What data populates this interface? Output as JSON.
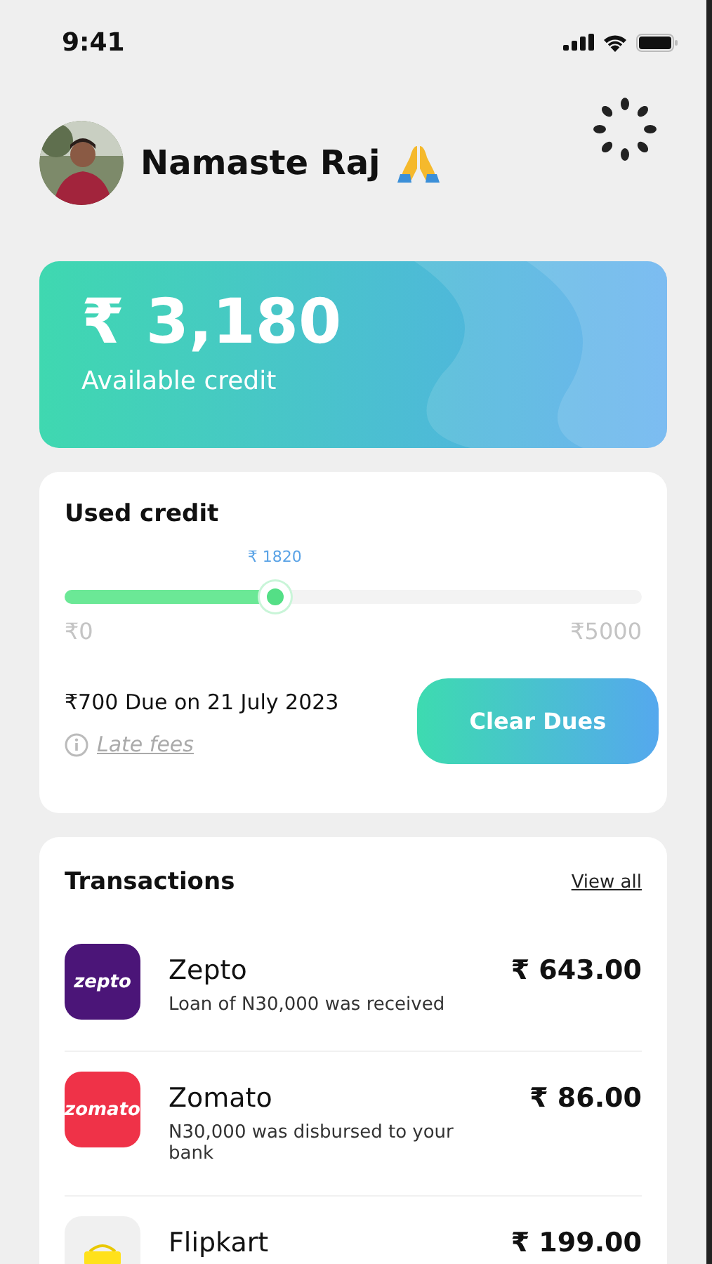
{
  "status_bar": {
    "time": "9:41"
  },
  "header": {
    "greeting": "Namaste Raj"
  },
  "balance": {
    "amount": "₹ 3,180",
    "label": "Available credit"
  },
  "used_credit": {
    "title": "Used credit",
    "slider": {
      "level": 0.364,
      "reading": "₹ 1820",
      "min_label": "₹0",
      "max_label": "₹5000"
    },
    "due": "₹700 Due on 21 July 2023",
    "late_fees": "Late fees",
    "button": "Clear Dues"
  },
  "transactions": {
    "title": "Transactions",
    "view_all": "View all",
    "items": [
      {
        "name": "Zepto",
        "description": "Loan of N30,000 was received",
        "amount": "₹ 643.00",
        "logo": {
          "kind": "text",
          "text": "zepto",
          "color": "#4b1578"
        }
      },
      {
        "name": "Zomato",
        "description": "N30,000 was disbursed to your bank",
        "amount": "₹ 86.00",
        "logo": {
          "kind": "text",
          "text": "zomato",
          "color": "#ef3248"
        }
      },
      {
        "name": "Flipkart",
        "amount": "₹ 199.00",
        "logo": {
          "kind": "bag",
          "color": "#f0f0f0"
        }
      }
    ]
  }
}
